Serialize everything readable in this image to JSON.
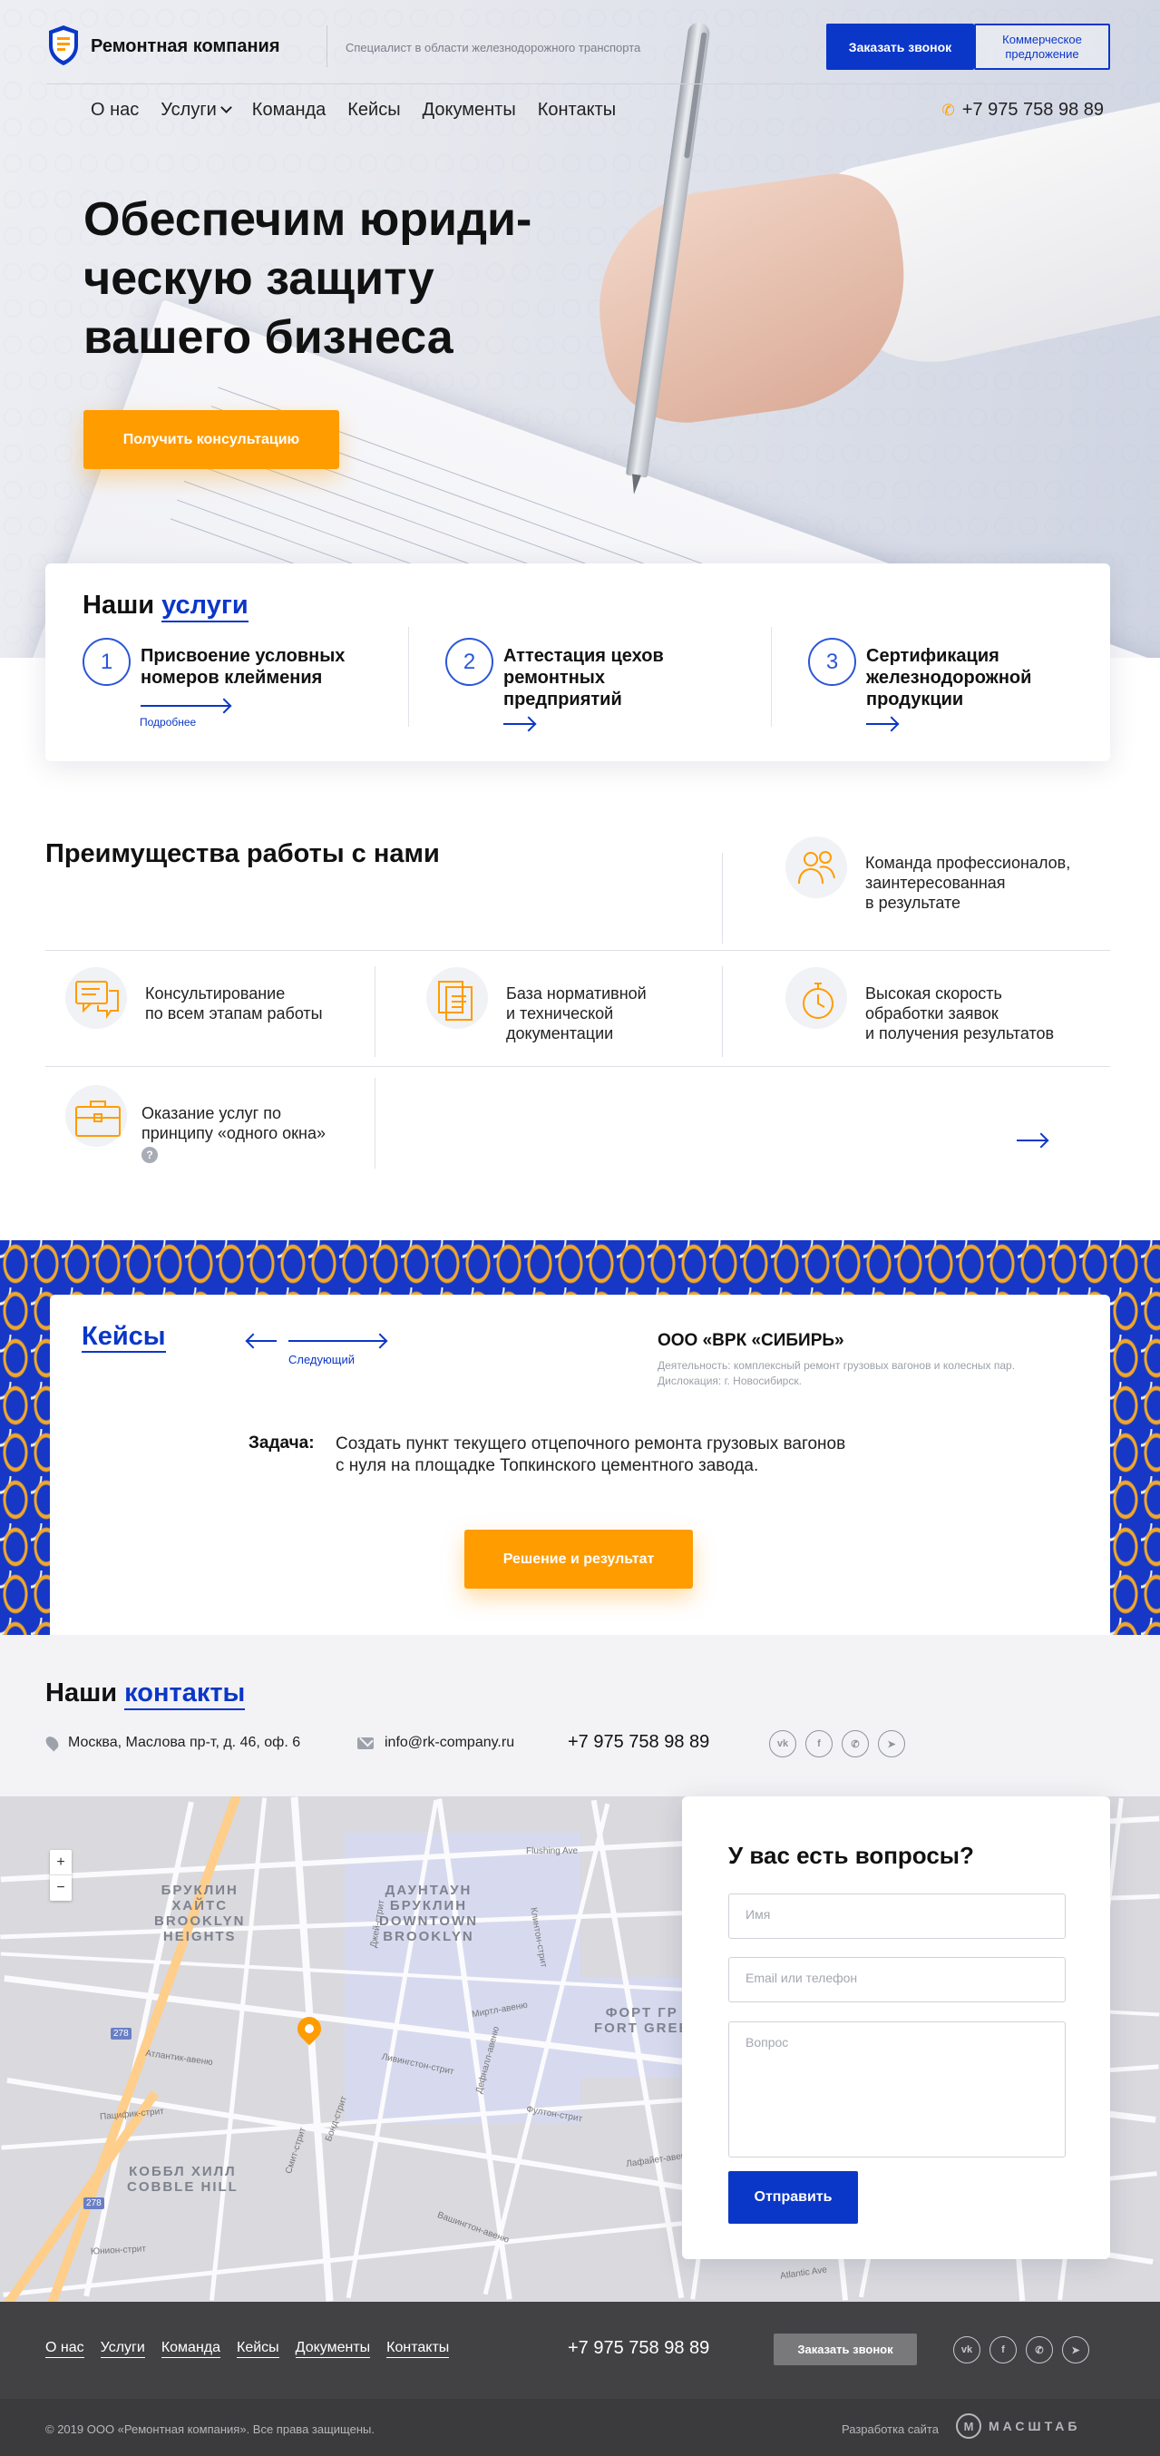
{
  "header": {
    "brand": "Ремонтная компания",
    "tagline": "Специалист в области железнодорожного транспорта",
    "call_button": "Заказать звонок",
    "offer_button": "Коммерческое предложение",
    "nav": [
      "О нас",
      "Услуги",
      "Команда",
      "Кейсы",
      "Документы",
      "Контакты"
    ],
    "phone": "+7 975 758 98 89"
  },
  "hero": {
    "title": "Обеспечим юриди-\nческую защиту\nвашего бизнеса",
    "button": "Получить консультацию"
  },
  "services": {
    "title_plain": "Наши ",
    "title_accent": "услуги",
    "items": [
      {
        "num": "1",
        "title": "Присвоение условных номеров клеймения",
        "more": "Подробнее"
      },
      {
        "num": "2",
        "title": "Аттестация цехов ремонтных предприятий",
        "more": ""
      },
      {
        "num": "3",
        "title": "Сертификация железнодорожной продукции",
        "more": ""
      }
    ]
  },
  "advantages": {
    "title": "Преимущества работы с нами",
    "items": [
      {
        "icon": "team-icon",
        "text": "Команда профессионалов,\nзаинтересованная\nв результате"
      },
      {
        "icon": "chat-icon",
        "text": "Консультирование\nпо всем этапам работы"
      },
      {
        "icon": "documents-icon",
        "text": "База нормативной\nи технической\nдокументации"
      },
      {
        "icon": "stopwatch-icon",
        "text": "Высокая скорость\nобработки заявок\nи получения результатов"
      },
      {
        "icon": "briefcase-icon",
        "text": "Оказание услуг по\nпринципу «одного окна»"
      }
    ],
    "help": "?"
  },
  "cases": {
    "title": "Кейсы",
    "next_label": "Следующий",
    "company": "ООО «ВРК «СИБИРЬ»",
    "activity": "Деятельность: комплексный ремонт грузовых вагонов и колесных пар.",
    "location": "Дислокация: г. Новосибирск.",
    "task_label": "Задача:",
    "task": "Создать пункт текущего отцепочного ремонта грузовых вагонов\nс нуля на площадке Топкинского цементного завода.",
    "button": "Решение и результат"
  },
  "contacts": {
    "title_plain": "Наши ",
    "title_accent": "контакты",
    "address": "Москва, Маслова пр-т, д. 46, оф. 6",
    "email": "info@rk-company.ru",
    "phone": "+7 975 758 98 89",
    "social": [
      "vk-icon",
      "facebook-icon",
      "whatsapp-icon",
      "telegram-icon"
    ]
  },
  "map": {
    "zoom_in": "+",
    "zoom_out": "−",
    "labels": {
      "brooklyn_heights": "БРУКЛИН\nХАЙТС\nBROOKLYN\nHEIGHTS",
      "downtown": "ДАУНТАУН\nБРУКЛИН\nDOWNTOWN\nBROOKLYN",
      "fort_greene": "ФОРТ ГР\nFORT GREE",
      "cobble_hill": "КОББЛ ХИЛЛ\nCOBBLE HILL"
    },
    "streets": [
      "Flushing Ave",
      "Атлантик-авеню",
      "Ливингстон-стрит",
      "Бонд-стрит",
      "Смит-стрит",
      "Дефналл-авеню",
      "Фултон-стрит",
      "Лафайет-авеню",
      "Миртл-авеню",
      "Клинтон-стрит",
      "Джей-стрит",
      "Atlantic Ave",
      "Пацифик-стрит",
      "Юнион-стрит",
      "Вашингтон-авеню"
    ],
    "shields": [
      "278",
      "278"
    ]
  },
  "form": {
    "title": "У вас есть вопросы?",
    "name_placeholder": "Имя",
    "contact_placeholder": "Email или телефон",
    "question_placeholder": "Вопрос",
    "submit": "Отправить"
  },
  "footer": {
    "nav": [
      "О нас",
      "Услуги",
      "Команда",
      "Кейсы",
      "Документы",
      "Контакты"
    ],
    "phone": "+7 975 758 98 89",
    "call_button": "Заказать звонок",
    "copyright": "© 2019  ООО «Ремонтная компания».  Все права защищены.",
    "developer": "Разработка сайта",
    "studio": "МАСШТАБ"
  },
  "colors": {
    "accent": "#0b37c8",
    "orange": "#ff9c00",
    "footer": "#424244"
  }
}
